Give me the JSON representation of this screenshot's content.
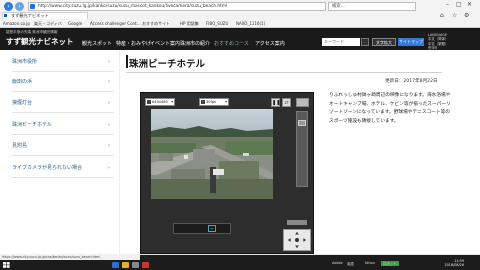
{
  "browser": {
    "address": "http://www.city.suzu.lg.jp/kanko/suzu/suzu_mascot_kankou/livecamera/suzu_beach.html",
    "search_placeholder": "検索...",
    "tab_label": "すず観光ナビネット",
    "favorites": [
      "Amazon.co.jp",
      "楽天・ゴディバ",
      "Google",
      "Access challenger Cont...",
      "おすすめサイト",
      "HP 用語集",
      "FIBO_SUZU",
      "NAXO_1116(1)"
    ],
    "status_url": "https://www.city.suzu.lg.jp/sns/kanko/suzu/suzu_beach.html"
  },
  "site": {
    "tagline": "能登半島の先端 珠洲市観光情報",
    "logo": "すず観光ナビネット",
    "nav": [
      "観光スポット",
      "特産・おみやげ",
      "イベント案内",
      "珠洲市の紹介",
      "おすすめコース",
      "アクセス案内"
    ],
    "search_placeholder": "キーワード",
    "btn_text_size": "文字拡大",
    "btn_sitemap": "サイトマップ",
    "lang_title": "LANGUAGE",
    "lang_items": [
      "中文（简体）",
      "中文（繁體）",
      "한국어"
    ]
  },
  "sidebar": {
    "items": [
      {
        "label": "珠洲市役所"
      },
      {
        "label": "飯田の浜"
      },
      {
        "label": "狼煙灯台"
      },
      {
        "label": "珠洲ビーチホテル"
      },
      {
        "label": "見附島"
      },
      {
        "label": "ライブカメラが見られない場合"
      }
    ]
  },
  "main": {
    "title": "珠洲ビーチホテル",
    "updated": "更新日：2017年8月22日",
    "description": "りふれっしゅ村鉢ヶ崎周辺の映像になります。海水浴場やオートキャンプ場、ホテル、ケビン等が揃ったスーパーリゾートゾーンになっています。野球場やテニスコート等のスポーツ施設も隣接しています。"
  },
  "camera": {
    "select1": "640x480",
    "select2": "30fps",
    "pause_label": "❚❚",
    "refresh_label": "⇄",
    "preset_marker": "+",
    "zoom_level": 0.12
  },
  "taskbar": {
    "tray_items": [
      "Adobe",
      "英語",
      "Nihon",
      "ロボット"
    ],
    "clock_time": "11:59",
    "clock_date": "2018/08/26"
  },
  "colors": {
    "header_bg": "#1a1a1a",
    "accent_blue": "#2a5f88",
    "button_blue": "#2f7bd6",
    "camera_bg": "#2d2d2d"
  }
}
